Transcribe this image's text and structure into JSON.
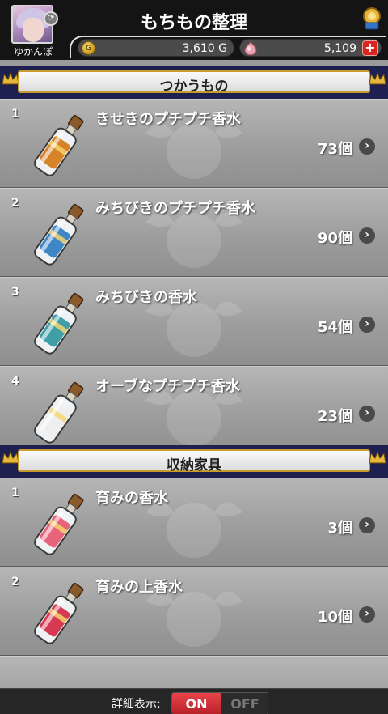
{
  "header": {
    "title": "もちもの整理",
    "player_name": "ゆかんぽ",
    "gold": "3,610 G",
    "gems": "5,109",
    "coin_glyph": "G",
    "plus": "+"
  },
  "sections": [
    {
      "label": "つかうもの",
      "items": [
        {
          "index": "1",
          "name": "きせきのプチプチ香水",
          "count": "73個",
          "bottle_color": "#d8822a"
        },
        {
          "index": "2",
          "name": "みちびきのプチプチ香水",
          "count": "90個",
          "bottle_color": "#3f86c4"
        },
        {
          "index": "3",
          "name": "みちびきの香水",
          "count": "54個",
          "bottle_color": "#3f9ea6"
        },
        {
          "index": "4",
          "name": "オーブなプチプチ香水",
          "count": "23個",
          "bottle_color": "#eeeeee"
        }
      ]
    },
    {
      "label": "収納家具",
      "items": [
        {
          "index": "1",
          "name": "育みの香水",
          "count": "3個",
          "bottle_color": "#e6637a"
        },
        {
          "index": "2",
          "name": "育みの上香水",
          "count": "10個",
          "bottle_color": "#d63a53"
        }
      ]
    }
  ],
  "footer": {
    "label": "詳細表示:",
    "on": "ON",
    "off": "OFF"
  },
  "colors": {
    "section_header_bg": "#1e2150",
    "crown_gold": "#e6b73a",
    "toggle_on": "#d6262d"
  },
  "icons": {
    "chevron": "›"
  }
}
